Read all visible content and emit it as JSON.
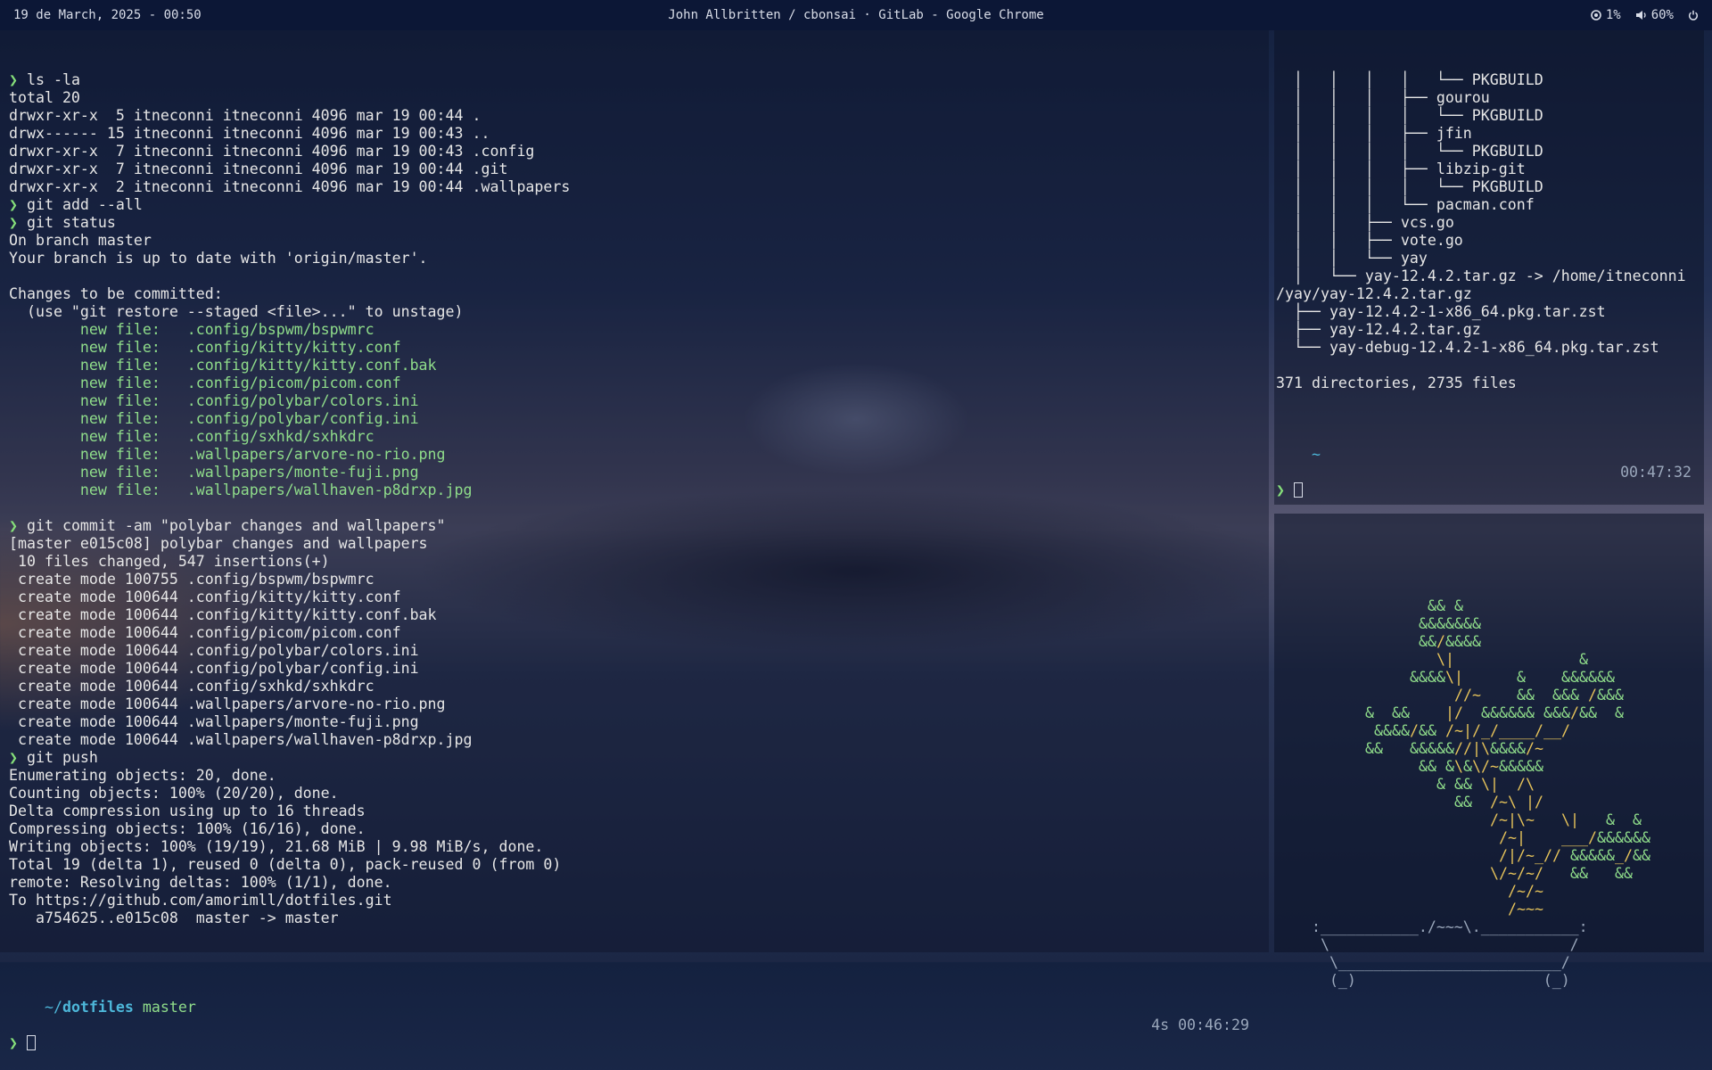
{
  "topbar": {
    "datetime": "19 de March, 2025 - 00:50",
    "window_title": "John Allbritten / cbonsai · GitLab - Google Chrome",
    "cpu": "1%",
    "volume": "60%"
  },
  "main_terminal": {
    "lines": [
      {
        "t": "❯ ls -la",
        "c": "cmd"
      },
      {
        "t": "total 20",
        "c": ""
      },
      {
        "t": "drwxr-xr-x  5 itneconni itneconni 4096 mar 19 00:44 .",
        "c": ""
      },
      {
        "t": "drwx------ 15 itneconni itneconni 4096 mar 19 00:43 ..",
        "c": ""
      },
      {
        "t": "drwxr-xr-x  7 itneconni itneconni 4096 mar 19 00:43 .config",
        "c": ""
      },
      {
        "t": "drwxr-xr-x  7 itneconni itneconni 4096 mar 19 00:44 .git",
        "c": ""
      },
      {
        "t": "drwxr-xr-x  2 itneconni itneconni 4096 mar 19 00:44 .wallpapers",
        "c": ""
      },
      {
        "t": "❯ git add --all",
        "c": "cmd"
      },
      {
        "t": "❯ git status",
        "c": "cmd"
      },
      {
        "t": "On branch master",
        "c": ""
      },
      {
        "t": "Your branch is up to date with 'origin/master'.",
        "c": ""
      },
      {
        "t": "",
        "c": ""
      },
      {
        "t": "Changes to be committed:",
        "c": ""
      },
      {
        "t": "  (use \"git restore --staged <file>...\" to unstage)",
        "c": ""
      },
      {
        "t": "        new file:   .config/bspwm/bspwmrc",
        "c": "green"
      },
      {
        "t": "        new file:   .config/kitty/kitty.conf",
        "c": "green"
      },
      {
        "t": "        new file:   .config/kitty/kitty.conf.bak",
        "c": "green"
      },
      {
        "t": "        new file:   .config/picom/picom.conf",
        "c": "green"
      },
      {
        "t": "        new file:   .config/polybar/colors.ini",
        "c": "green"
      },
      {
        "t": "        new file:   .config/polybar/config.ini",
        "c": "green"
      },
      {
        "t": "        new file:   .config/sxhkd/sxhkdrc",
        "c": "green"
      },
      {
        "t": "        new file:   .wallpapers/arvore-no-rio.png",
        "c": "green"
      },
      {
        "t": "        new file:   .wallpapers/monte-fuji.png",
        "c": "green"
      },
      {
        "t": "        new file:   .wallpapers/wallhaven-p8drxp.jpg",
        "c": "green"
      },
      {
        "t": "",
        "c": ""
      },
      {
        "t": "❯ git commit -am \"polybar changes and wallpapers\"",
        "c": "cmd"
      },
      {
        "t": "[master e015c08] polybar changes and wallpapers",
        "c": ""
      },
      {
        "t": " 10 files changed, 547 insertions(+)",
        "c": ""
      },
      {
        "t": " create mode 100755 .config/bspwm/bspwmrc",
        "c": ""
      },
      {
        "t": " create mode 100644 .config/kitty/kitty.conf",
        "c": ""
      },
      {
        "t": " create mode 100644 .config/kitty/kitty.conf.bak",
        "c": ""
      },
      {
        "t": " create mode 100644 .config/picom/picom.conf",
        "c": ""
      },
      {
        "t": " create mode 100644 .config/polybar/colors.ini",
        "c": ""
      },
      {
        "t": " create mode 100644 .config/polybar/config.ini",
        "c": ""
      },
      {
        "t": " create mode 100644 .config/sxhkd/sxhkdrc",
        "c": ""
      },
      {
        "t": " create mode 100644 .wallpapers/arvore-no-rio.png",
        "c": ""
      },
      {
        "t": " create mode 100644 .wallpapers/monte-fuji.png",
        "c": ""
      },
      {
        "t": " create mode 100644 .wallpapers/wallhaven-p8drxp.jpg",
        "c": ""
      },
      {
        "t": "❯ git push",
        "c": "cmd"
      },
      {
        "t": "Enumerating objects: 20, done.",
        "c": ""
      },
      {
        "t": "Counting objects: 100% (20/20), done.",
        "c": ""
      },
      {
        "t": "Delta compression using up to 16 threads",
        "c": ""
      },
      {
        "t": "Compressing objects: 100% (16/16), done.",
        "c": ""
      },
      {
        "t": "Writing objects: 100% (19/19), 21.68 MiB | 9.98 MiB/s, done.",
        "c": ""
      },
      {
        "t": "Total 19 (delta 1), reused 0 (delta 0), pack-reused 0 (from 0)",
        "c": ""
      },
      {
        "t": "remote: Resolving deltas: 100% (1/1), done.",
        "c": ""
      },
      {
        "t": "To https://github.com/amorimll/dotfiles.git",
        "c": ""
      },
      {
        "t": "   a754625..e015c08  master -> master",
        "c": ""
      },
      {
        "t": "",
        "c": ""
      }
    ],
    "prompt_path_prefix": "~/",
    "prompt_path": "dotfiles",
    "prompt_branch": "master",
    "prompt_duration": "4s",
    "prompt_time": "00:46:29",
    "prompt_symbol": "❯"
  },
  "tree_terminal": {
    "lines": [
      "  │   │   │   │   └── PKGBUILD",
      "  │   │   │   ├── gourou",
      "  │   │   │   │   └── PKGBUILD",
      "  │   │   │   ├── jfin",
      "  │   │   │   │   └── PKGBUILD",
      "  │   │   │   ├── libzip-git",
      "  │   │   │   │   └── PKGBUILD",
      "  │   │   │   └── pacman.conf",
      "  │   │   ├── vcs.go",
      "  │   │   ├── vote.go",
      "  │   │   └── yay",
      "  │   └── yay-12.4.2.tar.gz -> /home/itneconni",
      "/yay/yay-12.4.2.tar.gz",
      "  ├── yay-12.4.2-1-x86_64.pkg.tar.zst",
      "  ├── yay-12.4.2.tar.gz",
      "  └── yay-debug-12.4.2-1-x86_64.pkg.tar.zst",
      "",
      "371 directories, 2735 files"
    ],
    "prompt_path": "~",
    "prompt_time": "00:47:32",
    "prompt_symbol": "❯"
  },
  "bonsai": {
    "lines": [
      "                 && &",
      "                &&&&&&&",
      "                &&/&&&&",
      "                  \\|              &",
      "               &&&&\\|      &    &&&&&&",
      "                    //~    &&  &&& /&&&",
      "          &  &&    |/  &&&&&& &&&/&&  &",
      "           &&&&/&& /~|/_/____/__/",
      "          &&   &&&&&//|\\&&&&/~",
      "                && &\\&\\/~&&&&&",
      "                  & && \\|  /\\",
      "                    &&  /~\\ |/",
      "                        /~|\\~   \\|   &  &",
      "                         /~|    ___/&&&&&&",
      "                         /|/~_// &&&&&_/&&",
      "                        \\/~/~/   &&   &&",
      "                          /~/~",
      "                          /~~~",
      "    :___________./~~~\\.___________:",
      "     \\                           /",
      "      \\_________________________/",
      "      (_)                     (_)"
    ]
  }
}
